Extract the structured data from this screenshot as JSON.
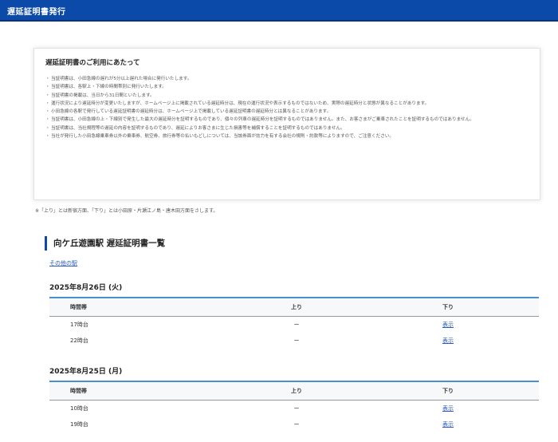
{
  "header": {
    "title": "遅延証明書発行"
  },
  "notice": {
    "title": "遅延証明書のご利用にあたって",
    "items": [
      "当証明書は、小田急線の遅れが5分以上遅れた場合に発行いたします。",
      "当証明書は、各駅上・下線の時間帯別に発行いたします。",
      "当証明書の掲載は、当日から31日間といたします。",
      "運行状況により遅延時分が変更いたしますが、ホームページ上に掲載されている遅延時分は、現在の運行状況や表示するものではないため、実際の遅延時分と状態が異なることがあります。",
      "小田急線の各駅で発行している遅延証明書の遅延時分は、ホームページ上で掲載している遅延証明書の遅延時分とは異なることがあります。",
      "当証明書は、小田急線の上・下線別で発生した最大の遅延時分を証明するものであり、個々の列車の遅延時分を証明するものではありません。また、お客さまがご乗車されたことを証明するものではありません。",
      "当証明書は、当社規程等の遅延の内容を証明するものであり、遅延によりお客さまに生じた損害等を補償することを証明するものではありません。",
      "当社が発行した小田急線乗車券以外の乗車券、航空券、旅行券等の払いもどしについては、当該券面が効力を有する会社の規則・約款等によりますので、ご注意ください。"
    ]
  },
  "footnote": "※「上り」とは新宿方面、「下り」とは小田原・片瀬江ノ島・唐木田方面をさします。",
  "section": {
    "title": "向ケ丘遊園駅 遅延証明書一覧",
    "other_link": "その他の駅"
  },
  "columns": {
    "time": "時間帯",
    "up": "上り",
    "down": "下り"
  },
  "days": [
    {
      "date": "2025年8月26日 (火)",
      "rows": [
        {
          "time": "17時台",
          "up": "ー",
          "down": "表示"
        },
        {
          "time": "22時台",
          "up": "ー",
          "down": "表示"
        }
      ]
    },
    {
      "date": "2025年8月25日 (月)",
      "rows": [
        {
          "time": "10時台",
          "up": "ー",
          "down": "表示"
        },
        {
          "time": "19時台",
          "up": "ー",
          "down": "表示"
        }
      ]
    }
  ]
}
